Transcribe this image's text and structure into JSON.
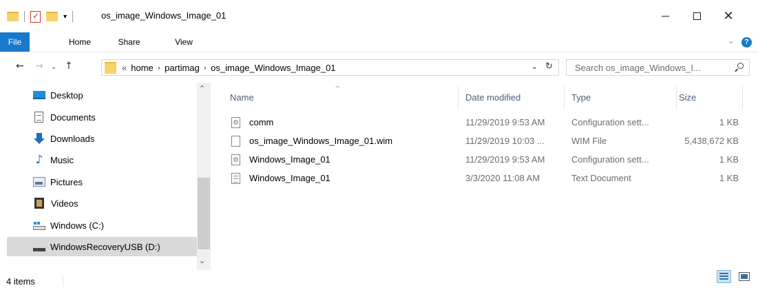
{
  "window": {
    "title": "os_image_Windows_Image_01",
    "controls": {
      "minimize": "—",
      "maximize": "☐",
      "close": "✕"
    }
  },
  "ribbon": {
    "tabs": [
      {
        "label": "File",
        "active": true
      },
      {
        "label": "Home"
      },
      {
        "label": "Share"
      },
      {
        "label": "View"
      }
    ],
    "help_label": "?"
  },
  "navigation": {
    "back": "←",
    "forward": "→",
    "recent": "⌄",
    "up": "↑"
  },
  "address": {
    "overflow": "«",
    "crumbs": [
      "home",
      "partimag",
      "os_image_Windows_Image_01"
    ],
    "separator": "›",
    "dropdown": "⌄",
    "refresh": "↻"
  },
  "search": {
    "placeholder": "Search os_image_Windows_I..."
  },
  "nav_pane": {
    "items": [
      {
        "label": "Desktop",
        "icon": "desktop-icon"
      },
      {
        "label": "Documents",
        "icon": "documents-icon"
      },
      {
        "label": "Downloads",
        "icon": "downloads-icon"
      },
      {
        "label": "Music",
        "icon": "music-icon"
      },
      {
        "label": "Pictures",
        "icon": "pictures-icon"
      },
      {
        "label": "Videos",
        "icon": "videos-icon"
      },
      {
        "label": "Windows (C:)",
        "icon": "drive-icon"
      },
      {
        "label": "WindowsRecoveryUSB (D:)",
        "icon": "usb-drive-icon",
        "selected": true
      }
    ],
    "scroll_up": "⌃",
    "scroll_down": "⌄"
  },
  "file_list": {
    "columns": {
      "name": "Name",
      "date": "Date modified",
      "type": "Type",
      "size": "Size"
    },
    "sort_indicator": "^",
    "rows": [
      {
        "name": "comm",
        "date": "11/29/2019 9:53 AM",
        "type": "Configuration sett...",
        "size": "1 KB",
        "icon": "config-file-icon"
      },
      {
        "name": "os_image_Windows_Image_01.wim",
        "date": "11/29/2019 10:03 ...",
        "type": "WIM File",
        "size": "5,438,672 KB",
        "icon": "file-icon"
      },
      {
        "name": "Windows_Image_01",
        "date": "11/29/2019 9:53 AM",
        "type": "Configuration sett...",
        "size": "1 KB",
        "icon": "config-file-icon"
      },
      {
        "name": "Windows_Image_01",
        "date": "3/3/2020 11:08 AM",
        "type": "Text Document",
        "size": "1 KB",
        "icon": "text-file-icon"
      }
    ]
  },
  "status": {
    "item_count": "4 items"
  },
  "colors": {
    "accent": "#1979ca",
    "selected_nav": "#d9d9d9",
    "column_header": "#4c607a",
    "secondary_text": "#6d6d6d"
  }
}
